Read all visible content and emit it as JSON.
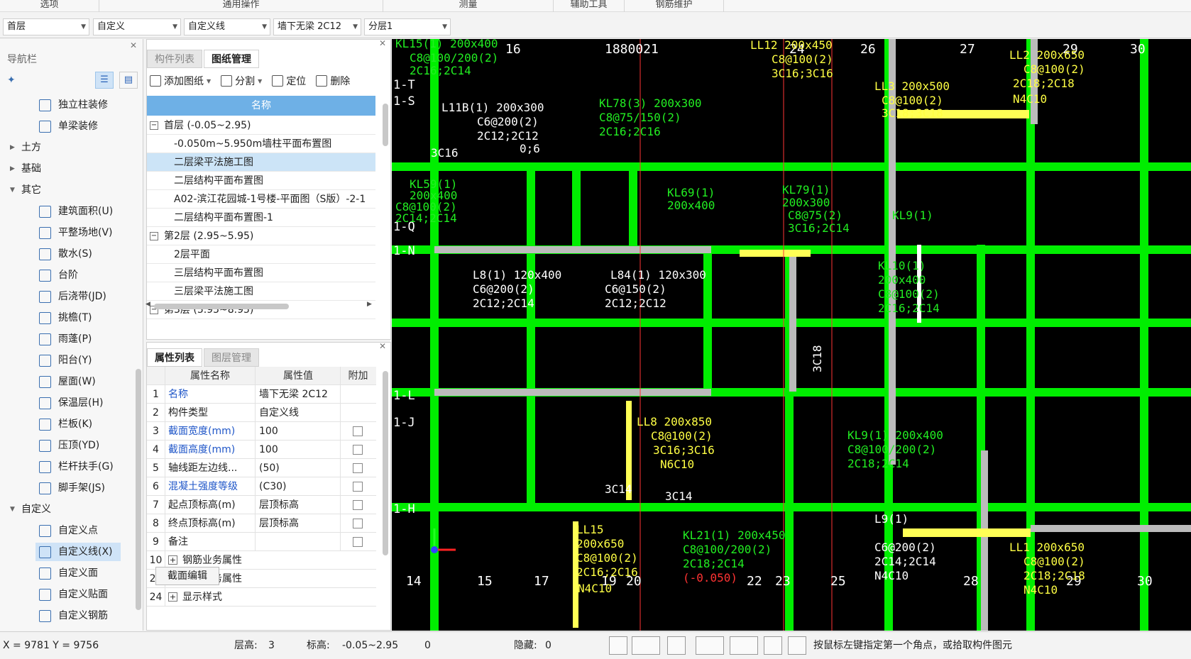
{
  "ribbon": {
    "tabs": [
      "选项",
      "通用操作",
      "测量",
      "辅助工具",
      "钢筋维护"
    ]
  },
  "selectors": {
    "floor": "首层",
    "category": "自定义",
    "type": "自定义线",
    "component": "墙下无梁 2C12",
    "layer": "分层1"
  },
  "nav": {
    "title": "导航栏",
    "items": [
      {
        "label": "独立柱装修",
        "icon": "column-icon"
      },
      {
        "label": "单梁装修",
        "icon": "beam-icon"
      },
      {
        "group": "土方",
        "expanded": false
      },
      {
        "group": "基础",
        "expanded": false
      },
      {
        "group": "其它",
        "expanded": true
      },
      {
        "label": "建筑面积(U)",
        "icon": "area-icon"
      },
      {
        "label": "平整场地(V)",
        "icon": "site-icon"
      },
      {
        "label": "散水(S)",
        "icon": "apron-icon"
      },
      {
        "label": "台阶",
        "icon": "step-icon"
      },
      {
        "label": "后浇带(JD)",
        "icon": "pour-strip-icon"
      },
      {
        "label": "挑檐(T)",
        "icon": "eave-icon"
      },
      {
        "label": "雨蓬(P)",
        "icon": "canopy-icon"
      },
      {
        "label": "阳台(Y)",
        "icon": "balcony-icon"
      },
      {
        "label": "屋面(W)",
        "icon": "roof-icon"
      },
      {
        "label": "保温层(H)",
        "icon": "insulation-icon"
      },
      {
        "label": "栏板(K)",
        "icon": "parapet-icon"
      },
      {
        "label": "压顶(YD)",
        "icon": "coping-icon"
      },
      {
        "label": "栏杆扶手(G)",
        "icon": "railing-icon"
      },
      {
        "label": "脚手架(JS)",
        "icon": "scaffold-icon"
      },
      {
        "group": "自定义",
        "expanded": true
      },
      {
        "label": "自定义点",
        "icon": "custom-point-icon"
      },
      {
        "label": "自定义线(X)",
        "icon": "custom-line-icon",
        "selected": true
      },
      {
        "label": "自定义面",
        "icon": "custom-face-icon"
      },
      {
        "label": "自定义贴面",
        "icon": "custom-cladding-icon"
      },
      {
        "label": "自定义钢筋",
        "icon": "custom-rebar-icon"
      }
    ]
  },
  "drawings": {
    "tabs": [
      "构件列表",
      "图纸管理"
    ],
    "toolbar": [
      "添加图纸",
      "分割",
      "定位",
      "删除"
    ],
    "header": "名称",
    "rows": [
      {
        "text": "首层 (-0.05~2.95)",
        "level": 0,
        "box": "−"
      },
      {
        "text": "-0.050m~5.950m墙柱平面布置图",
        "level": 1
      },
      {
        "text": "二层梁平法施工图",
        "level": 1,
        "selected": true
      },
      {
        "text": "二层结构平面布置图",
        "level": 1
      },
      {
        "text": "A02-滨江花园城-1号楼-平面图（S版）-2-1",
        "level": 1
      },
      {
        "text": "二层结构平面布置图-1",
        "level": 1
      },
      {
        "text": "第2层 (2.95~5.95)",
        "level": 0,
        "box": "−"
      },
      {
        "text": "2层平面",
        "level": 1
      },
      {
        "text": "三层结构平面布置图",
        "level": 1
      },
      {
        "text": "三层梁平法施工图",
        "level": 1
      },
      {
        "text": "第3层 (5.95~8.95)",
        "level": 0,
        "box": "−"
      }
    ]
  },
  "props": {
    "tabs": [
      "属性列表",
      "图层管理"
    ],
    "headers": [
      "属性名称",
      "属性值",
      "附加"
    ],
    "rows": [
      {
        "n": "1",
        "k": "名称",
        "v": "墙下无梁 2C12",
        "blue": true,
        "cb": false
      },
      {
        "n": "2",
        "k": "构件类型",
        "v": "自定义线",
        "blue": false,
        "cb": false
      },
      {
        "n": "3",
        "k": "截面宽度(mm)",
        "v": "100",
        "blue": true,
        "cb": true
      },
      {
        "n": "4",
        "k": "截面高度(mm)",
        "v": "100",
        "blue": true,
        "cb": true
      },
      {
        "n": "5",
        "k": "轴线距左边线...",
        "v": "(50)",
        "blue": false,
        "cb": true
      },
      {
        "n": "6",
        "k": "混凝土强度等级",
        "v": "(C30)",
        "blue": true,
        "cb": true
      },
      {
        "n": "7",
        "k": "起点顶标高(m)",
        "v": "层顶标高",
        "blue": false,
        "cb": true
      },
      {
        "n": "8",
        "k": "终点顶标高(m)",
        "v": "层顶标高",
        "blue": false,
        "cb": true
      },
      {
        "n": "9",
        "k": "备注",
        "v": "",
        "blue": false,
        "cb": true
      },
      {
        "n": "10",
        "k": "钢筋业务属性",
        "v": "",
        "blue": false,
        "cb": false,
        "plus": true
      },
      {
        "n": "20",
        "k": "土建业务属性",
        "v": "",
        "blue": false,
        "cb": false,
        "plus": true
      },
      {
        "n": "24",
        "k": "显示样式",
        "v": "",
        "blue": false,
        "cb": false,
        "plus": true
      }
    ],
    "edit_button": "截面编辑"
  },
  "cad": {
    "axis_top": [
      "16",
      "1880021",
      "24",
      "26",
      "27",
      "29",
      "30"
    ],
    "axis_bottom": [
      "14",
      "15",
      "17",
      "19",
      "20",
      "22",
      "23",
      "25",
      "28",
      "29",
      "30"
    ],
    "axis_left": [
      "1-T",
      "1-S",
      "1-Q",
      "1-N",
      "1-L",
      "1-J",
      "1-H"
    ],
    "beam_labels": [
      {
        "t": "KL15(1) 200x400",
        "c": "green"
      },
      {
        "t": "C8@100/200(2)",
        "c": "green"
      },
      {
        "t": "2C16;2C14",
        "c": "green"
      },
      {
        "t": "L11B(1) 200x300",
        "c": "white"
      },
      {
        "t": "C6@200(2)",
        "c": "white"
      },
      {
        "t": "2C12;2C12",
        "c": "white"
      },
      {
        "t": "KL78(3) 200x300",
        "c": "green"
      },
      {
        "t": "C8@75/150(2)",
        "c": "green"
      },
      {
        "t": "2C16;2C16",
        "c": "green"
      },
      {
        "t": "LL12 200x450",
        "c": "yellow"
      },
      {
        "t": "C8@100(2)",
        "c": "yellow"
      },
      {
        "t": "3C16;3C16",
        "c": "yellow"
      },
      {
        "t": "LL3 200x500",
        "c": "yellow"
      },
      {
        "t": "C8@100(2)",
        "c": "yellow"
      },
      {
        "t": "3C18;3C18",
        "c": "yellow"
      },
      {
        "t": "LL2 200x650",
        "c": "yellow"
      },
      {
        "t": "C8@100(2)",
        "c": "yellow"
      },
      {
        "t": "2C18;2C18",
        "c": "yellow"
      },
      {
        "t": "N4C10",
        "c": "yellow"
      },
      {
        "t": "3C16",
        "c": "white"
      },
      {
        "t": "0;6",
        "c": "white"
      },
      {
        "t": "KL59(1)",
        "c": "green"
      },
      {
        "t": "200x400",
        "c": "green"
      },
      {
        "t": "C8@100(2)",
        "c": "green"
      },
      {
        "t": "2C14;2C14",
        "c": "green"
      },
      {
        "t": "KL69(1)",
        "c": "green"
      },
      {
        "t": "200x400",
        "c": "green"
      },
      {
        "t": "KL79(1)",
        "c": "green"
      },
      {
        "t": "200x300",
        "c": "green"
      },
      {
        "t": "C8@75(2)",
        "c": "green"
      },
      {
        "t": "3C16;2C14",
        "c": "green"
      },
      {
        "t": "KL9(1)",
        "c": "green"
      },
      {
        "t": "L8(1) 120x400",
        "c": "white"
      },
      {
        "t": "C6@200(2)",
        "c": "white"
      },
      {
        "t": "2C12;2C14",
        "c": "white"
      },
      {
        "t": "L84(1) 120x300",
        "c": "white"
      },
      {
        "t": "C6@150(2)",
        "c": "white"
      },
      {
        "t": "2C12;2C12",
        "c": "white"
      },
      {
        "t": "KL10(1)",
        "c": "green"
      },
      {
        "t": "200x400",
        "c": "green"
      },
      {
        "t": "C8@100(2)",
        "c": "green"
      },
      {
        "t": "2C16;2C14",
        "c": "green"
      },
      {
        "t": "LL8 200x850",
        "c": "yellow"
      },
      {
        "t": "C8@100(2)",
        "c": "yellow"
      },
      {
        "t": "3C16;3C16",
        "c": "yellow"
      },
      {
        "t": "N6C10",
        "c": "yellow"
      },
      {
        "t": "KL9(1) 200x400",
        "c": "green"
      },
      {
        "t": "C8@100/200(2)",
        "c": "green"
      },
      {
        "t": "2C18;2C14",
        "c": "green"
      },
      {
        "t": "3C14",
        "c": "white"
      },
      {
        "t": "LL15",
        "c": "yellow"
      },
      {
        "t": "200x650",
        "c": "yellow"
      },
      {
        "t": "C8@100(2)",
        "c": "yellow"
      },
      {
        "t": "2C16;2C16",
        "c": "yellow"
      },
      {
        "t": "N4C10",
        "c": "yellow"
      },
      {
        "t": "KL21(1) 200x450",
        "c": "green"
      },
      {
        "t": "C8@100/200(2)",
        "c": "green"
      },
      {
        "t": "2C18;2C14",
        "c": "green"
      },
      {
        "t": "(-0.050)",
        "c": "red"
      },
      {
        "t": "L9(1)",
        "c": "white"
      },
      {
        "t": "C6@200(2)",
        "c": "white"
      },
      {
        "t": "2C14;2C14",
        "c": "white"
      },
      {
        "t": "N4C10",
        "c": "white"
      },
      {
        "t": "LL1 200x650",
        "c": "yellow"
      },
      {
        "t": "C8@100(2)",
        "c": "yellow"
      },
      {
        "t": "2C18;2C18",
        "c": "yellow"
      },
      {
        "t": "N4C10",
        "c": "yellow"
      },
      {
        "t": "3C18",
        "c": "white"
      },
      {
        "t": "3C14",
        "c": "white"
      }
    ]
  },
  "status": {
    "coords": "X = 9781 Y = 9756",
    "floor_height_label": "层高:",
    "floor_height": "3",
    "elevation_label": "标高:",
    "elevation": "-0.05~2.95",
    "zero": "0",
    "hidden_label": "隐藏:",
    "hidden": "0",
    "hint": "按鼠标左键指定第一个角点，或拾取构件图元"
  },
  "colors": {
    "accent": "#6eb0e6",
    "beam_green": "#22cc22",
    "yellow": "#ffff55",
    "cad_bg": "#000000"
  }
}
